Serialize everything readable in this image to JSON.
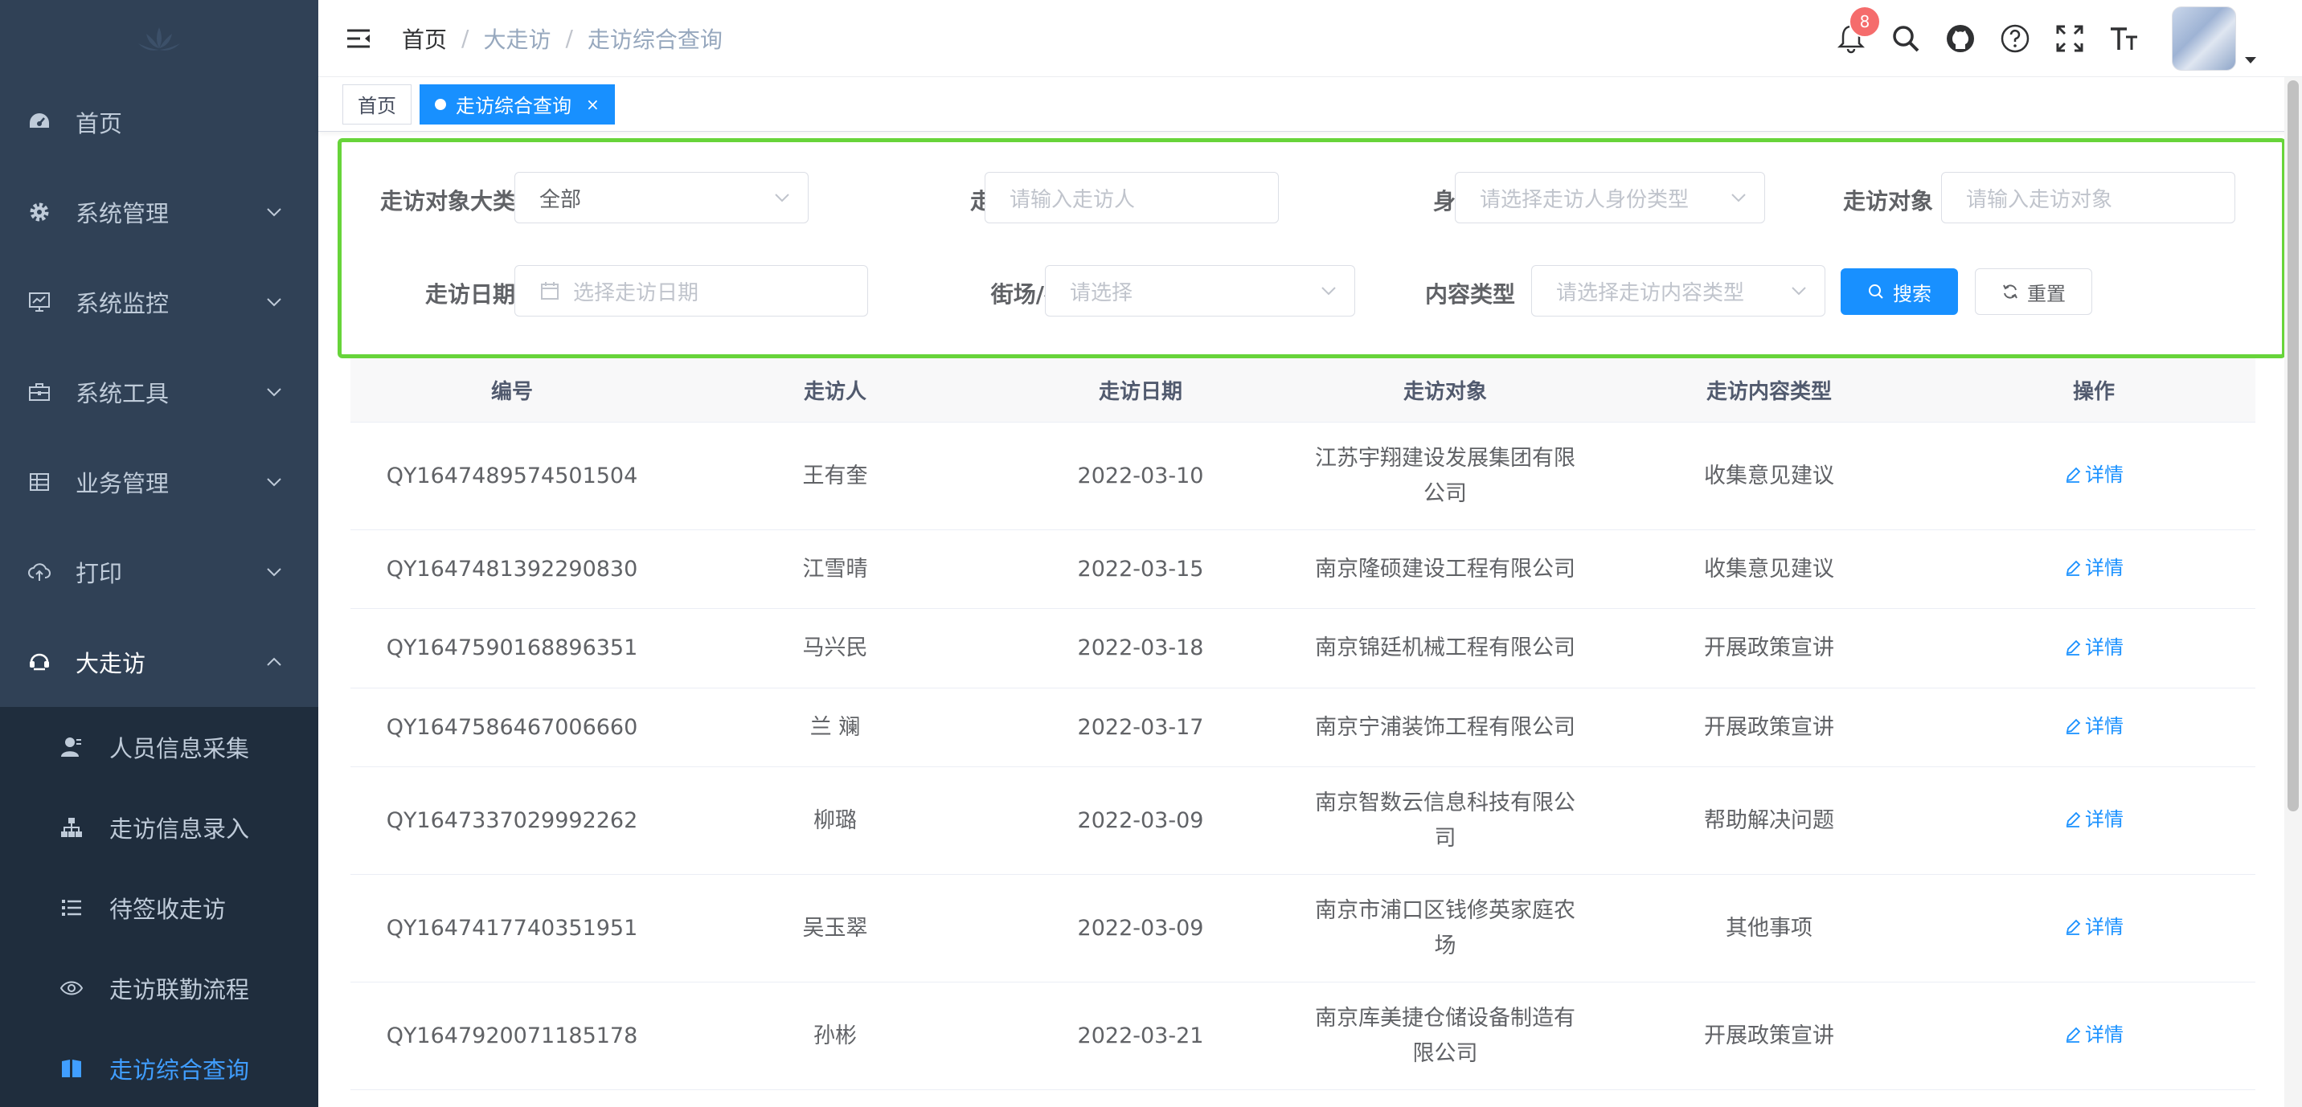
{
  "sidebar": {
    "items": [
      {
        "label": "首页",
        "icon": "dashboard-icon"
      },
      {
        "label": "系统管理",
        "icon": "gear-icon"
      },
      {
        "label": "系统监控",
        "icon": "monitor-icon"
      },
      {
        "label": "系统工具",
        "icon": "toolbox-icon"
      },
      {
        "label": "业务管理",
        "icon": "table-icon"
      },
      {
        "label": "打印",
        "icon": "cloud-upload-icon"
      },
      {
        "label": "大走访",
        "icon": "visitor-icon"
      }
    ],
    "sub_items": [
      {
        "label": "人员信息采集",
        "icon": "user-icon"
      },
      {
        "label": "走访信息录入",
        "icon": "tree-icon"
      },
      {
        "label": "待签收走访",
        "icon": "list-icon"
      },
      {
        "label": "走访联勤流程",
        "icon": "eye-icon"
      },
      {
        "label": "走访综合查询",
        "icon": "book-icon"
      }
    ]
  },
  "header": {
    "breadcrumb": [
      "首页",
      "大走访",
      "走访综合查询"
    ],
    "notification_count": "8"
  },
  "tags": {
    "home": "首页",
    "active": "走访综合查询",
    "close": "×"
  },
  "filter": {
    "category_label": "走访对象大类",
    "category_value": "全部",
    "visitor_label": "走访人",
    "visitor_placeholder": "请输入走访人",
    "identity_label": "身份类型",
    "identity_placeholder": "请选择走访人身份类型",
    "target_label": "走访对象",
    "target_placeholder": "请输入走访对象",
    "date_label": "走访日期",
    "date_placeholder": "选择走访日期",
    "street_label": "街场/社区",
    "street_placeholder": "请选择",
    "content_label": "内容类型",
    "content_placeholder": "请选择走访内容类型",
    "search_button": "搜索",
    "reset_button": "重置"
  },
  "table": {
    "columns": [
      "编号",
      "走访人",
      "走访日期",
      "走访对象",
      "走访内容类型",
      "操作"
    ],
    "rows": [
      {
        "id": "QY1647489574501504",
        "visitor": "王有奎",
        "date": "2022-03-10",
        "target_l1": "江苏宇翔建设发展集团有限",
        "target_l2": "公司",
        "type": "收集意见建议",
        "action": "详情"
      },
      {
        "id": "QY1647481392290830",
        "visitor": "江雪晴",
        "date": "2022-03-15",
        "target_l1": "南京隆硕建设工程有限公司",
        "target_l2": "",
        "type": "收集意见建议",
        "action": "详情"
      },
      {
        "id": "QY1647590168896351",
        "visitor": "马兴民",
        "date": "2022-03-18",
        "target_l1": "南京锦廷机械工程有限公司",
        "target_l2": "",
        "type": "开展政策宣讲",
        "action": "详情"
      },
      {
        "id": "QY1647586467006660",
        "visitor": "兰 斓",
        "date": "2022-03-17",
        "target_l1": "南京宁浦装饰工程有限公司",
        "target_l2": "",
        "type": "开展政策宣讲",
        "action": "详情"
      },
      {
        "id": "QY1647337029992262",
        "visitor": "柳璐",
        "date": "2022-03-09",
        "target_l1": "南京智数云信息科技有限公",
        "target_l2": "司",
        "type": "帮助解决问题",
        "action": "详情"
      },
      {
        "id": "QY1647417740351951",
        "visitor": "吴玉翠",
        "date": "2022-03-09",
        "target_l1": "南京市浦口区钱修英家庭农",
        "target_l2": "场",
        "type": "其他事项",
        "action": "详情"
      },
      {
        "id": "QY1647920071185178",
        "visitor": "孙彬",
        "date": "2022-03-21",
        "target_l1": "南京库美捷仓储设备制造有",
        "target_l2": "限公司",
        "type": "开展政策宣讲",
        "action": "详情"
      }
    ]
  },
  "colors": {
    "sidebar_bg": "#304156",
    "submenu_bg": "#1f2d3d",
    "accent": "#1890ff",
    "filter_border": "#67d43a",
    "badge": "#f56c6c"
  }
}
